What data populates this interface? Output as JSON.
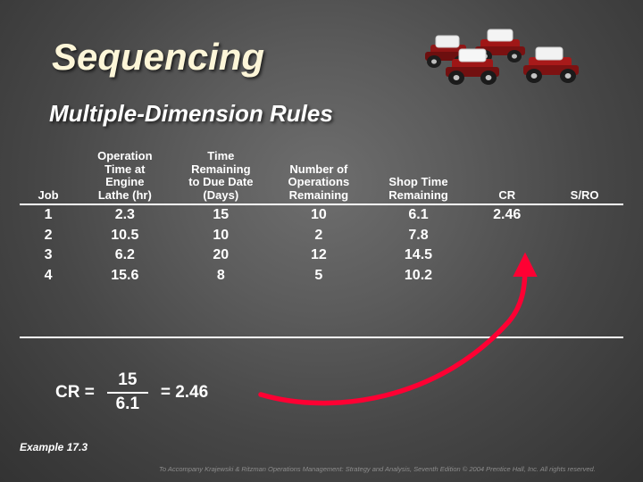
{
  "slide": {
    "title": "Sequencing",
    "subtitle": "Multiple-Dimension Rules",
    "example_label": "Example 17.3",
    "copyright": "To Accompany Krajewski & Ritzman Operations Management: Strategy and Analysis, Seventh Edition © 2004 Prentice Hall, Inc. All rights reserved.",
    "accent_color": "#ff0033",
    "title_color": "#fdf6d8"
  },
  "table": {
    "headers": [
      {
        "lines": [
          "Job"
        ]
      },
      {
        "lines": [
          "Operation",
          "Time at",
          "Engine",
          "Lathe (hr)"
        ]
      },
      {
        "lines": [
          "Time",
          "Remaining",
          "to Due Date",
          "(Days)"
        ]
      },
      {
        "lines": [
          "Number of",
          "Operations",
          "Remaining"
        ]
      },
      {
        "lines": [
          "Shop Time",
          "Remaining"
        ]
      },
      {
        "lines": [
          "CR"
        ]
      },
      {
        "lines": [
          "S/RO"
        ]
      }
    ],
    "rows": [
      {
        "job": "1",
        "engine_lathe": "2.3",
        "time_remaining": "15",
        "num_operations": "10",
        "shop_time": "6.1",
        "cr": "2.46",
        "sro": ""
      },
      {
        "job": "2",
        "engine_lathe": "10.5",
        "time_remaining": "10",
        "num_operations": "2",
        "shop_time": "7.8",
        "cr": "",
        "sro": ""
      },
      {
        "job": "3",
        "engine_lathe": "6.2",
        "time_remaining": "20",
        "num_operations": "12",
        "shop_time": "14.5",
        "cr": "",
        "sro": ""
      },
      {
        "job": "4",
        "engine_lathe": "15.6",
        "time_remaining": "8",
        "num_operations": "5",
        "shop_time": "10.2",
        "cr": "",
        "sro": ""
      }
    ]
  },
  "formula": {
    "label": "CR =",
    "numerator": "15",
    "denominator": "6.1",
    "result": "= 2.46"
  },
  "icons": {
    "trucks": "truck-convoy-icon",
    "arrow": "curved-arrow-icon"
  }
}
